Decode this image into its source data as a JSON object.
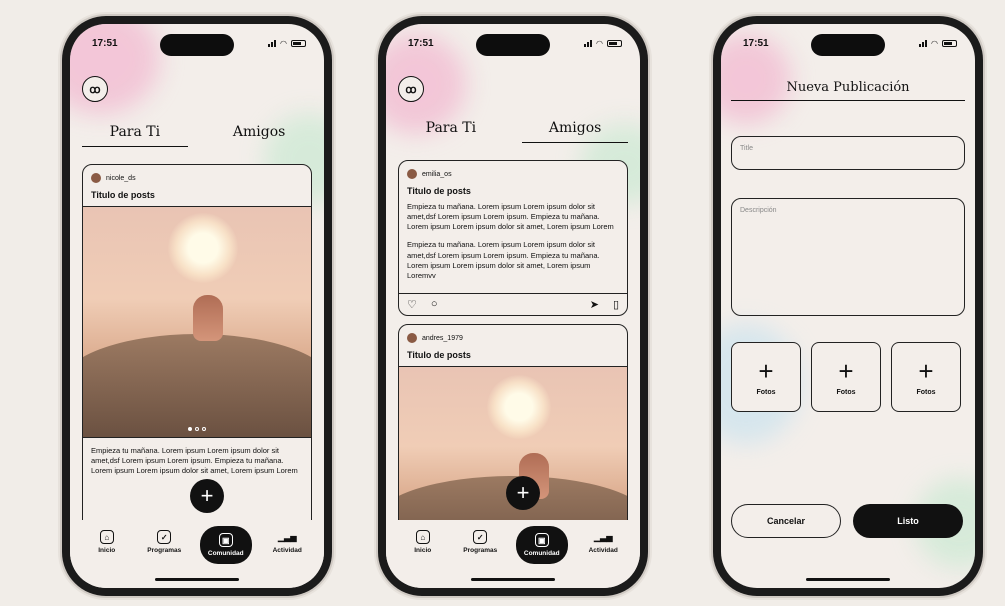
{
  "colors": {
    "background": "#f1ede8",
    "screen": "#f3eeea",
    "accent": "#111111"
  },
  "phone1": {
    "time": "17:51",
    "tabs": [
      "Para Ti",
      "Amigos"
    ],
    "post": {
      "user": "nicole_ds",
      "title": "Titulo de posts",
      "body": "Empieza tu mañana. Lorem ipsum Lorem ipsum dolor sit amet,dsf Lorem ipsum Lorem ipsum. Empieza tu mañana. Lorem ipsum Lorem ipsum dolor sit amet, Lorem ipsum Lorem",
      "carousel_index": 1,
      "carousel_total": 3
    },
    "nav": [
      "Inicio",
      "Programas",
      "Comunidad",
      "Actividad"
    ],
    "nav_active": "Comunidad"
  },
  "phone2": {
    "time": "17:51",
    "tabs": [
      "Para Ti",
      "Amigos"
    ],
    "post1": {
      "user": "emilia_os",
      "title": "Titulo de posts",
      "body1": "Empieza tu mañana. Lorem ipsum Lorem ipsum dolor sit amet,dsf Lorem ipsum Lorem ipsum. Empieza tu mañana. Lorem ipsum Lorem ipsum dolor sit amet, Lorem ipsum Lorem",
      "body2": "Empieza tu mañana. Lorem ipsum Lorem ipsum dolor sit amet,dsf Lorem ipsum Lorem ipsum. Empieza tu mañana. Lorem ipsum Lorem ipsum dolor sit amet, Lorem ipsum Loremvv"
    },
    "post2": {
      "user": "andres_1979",
      "title": "Titulo de posts"
    },
    "nav": [
      "Inicio",
      "Programas",
      "Comunidad",
      "Actividad"
    ],
    "nav_active": "Comunidad"
  },
  "phone3": {
    "time": "17:51",
    "title": "Nueva Publicación",
    "title_placeholder": "Title",
    "description_placeholder": "Descripción",
    "photos": [
      "Fotos",
      "Fotos",
      "Fotos"
    ],
    "cancel": "Cancelar",
    "done": "Listo"
  }
}
